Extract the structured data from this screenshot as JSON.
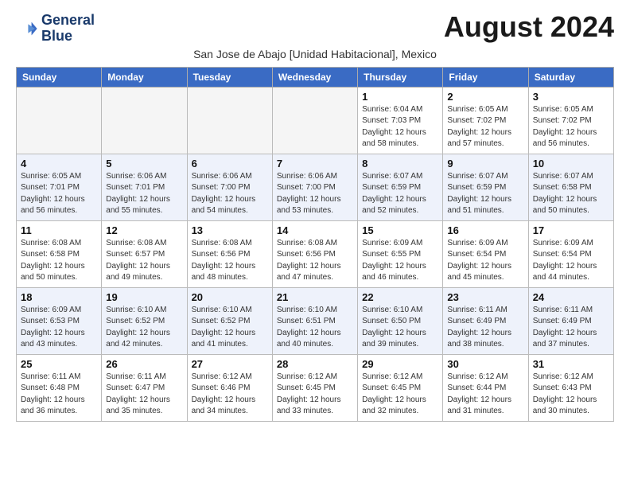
{
  "header": {
    "logo_line1": "General",
    "logo_line2": "Blue",
    "month_year": "August 2024",
    "subtitle": "San Jose de Abajo [Unidad Habitacional], Mexico"
  },
  "days_of_week": [
    "Sunday",
    "Monday",
    "Tuesday",
    "Wednesday",
    "Thursday",
    "Friday",
    "Saturday"
  ],
  "weeks": [
    [
      {
        "num": "",
        "info": ""
      },
      {
        "num": "",
        "info": ""
      },
      {
        "num": "",
        "info": ""
      },
      {
        "num": "",
        "info": ""
      },
      {
        "num": "1",
        "info": "Sunrise: 6:04 AM\nSunset: 7:03 PM\nDaylight: 12 hours\nand 58 minutes."
      },
      {
        "num": "2",
        "info": "Sunrise: 6:05 AM\nSunset: 7:02 PM\nDaylight: 12 hours\nand 57 minutes."
      },
      {
        "num": "3",
        "info": "Sunrise: 6:05 AM\nSunset: 7:02 PM\nDaylight: 12 hours\nand 56 minutes."
      }
    ],
    [
      {
        "num": "4",
        "info": "Sunrise: 6:05 AM\nSunset: 7:01 PM\nDaylight: 12 hours\nand 56 minutes."
      },
      {
        "num": "5",
        "info": "Sunrise: 6:06 AM\nSunset: 7:01 PM\nDaylight: 12 hours\nand 55 minutes."
      },
      {
        "num": "6",
        "info": "Sunrise: 6:06 AM\nSunset: 7:00 PM\nDaylight: 12 hours\nand 54 minutes."
      },
      {
        "num": "7",
        "info": "Sunrise: 6:06 AM\nSunset: 7:00 PM\nDaylight: 12 hours\nand 53 minutes."
      },
      {
        "num": "8",
        "info": "Sunrise: 6:07 AM\nSunset: 6:59 PM\nDaylight: 12 hours\nand 52 minutes."
      },
      {
        "num": "9",
        "info": "Sunrise: 6:07 AM\nSunset: 6:59 PM\nDaylight: 12 hours\nand 51 minutes."
      },
      {
        "num": "10",
        "info": "Sunrise: 6:07 AM\nSunset: 6:58 PM\nDaylight: 12 hours\nand 50 minutes."
      }
    ],
    [
      {
        "num": "11",
        "info": "Sunrise: 6:08 AM\nSunset: 6:58 PM\nDaylight: 12 hours\nand 50 minutes."
      },
      {
        "num": "12",
        "info": "Sunrise: 6:08 AM\nSunset: 6:57 PM\nDaylight: 12 hours\nand 49 minutes."
      },
      {
        "num": "13",
        "info": "Sunrise: 6:08 AM\nSunset: 6:56 PM\nDaylight: 12 hours\nand 48 minutes."
      },
      {
        "num": "14",
        "info": "Sunrise: 6:08 AM\nSunset: 6:56 PM\nDaylight: 12 hours\nand 47 minutes."
      },
      {
        "num": "15",
        "info": "Sunrise: 6:09 AM\nSunset: 6:55 PM\nDaylight: 12 hours\nand 46 minutes."
      },
      {
        "num": "16",
        "info": "Sunrise: 6:09 AM\nSunset: 6:54 PM\nDaylight: 12 hours\nand 45 minutes."
      },
      {
        "num": "17",
        "info": "Sunrise: 6:09 AM\nSunset: 6:54 PM\nDaylight: 12 hours\nand 44 minutes."
      }
    ],
    [
      {
        "num": "18",
        "info": "Sunrise: 6:09 AM\nSunset: 6:53 PM\nDaylight: 12 hours\nand 43 minutes."
      },
      {
        "num": "19",
        "info": "Sunrise: 6:10 AM\nSunset: 6:52 PM\nDaylight: 12 hours\nand 42 minutes."
      },
      {
        "num": "20",
        "info": "Sunrise: 6:10 AM\nSunset: 6:52 PM\nDaylight: 12 hours\nand 41 minutes."
      },
      {
        "num": "21",
        "info": "Sunrise: 6:10 AM\nSunset: 6:51 PM\nDaylight: 12 hours\nand 40 minutes."
      },
      {
        "num": "22",
        "info": "Sunrise: 6:10 AM\nSunset: 6:50 PM\nDaylight: 12 hours\nand 39 minutes."
      },
      {
        "num": "23",
        "info": "Sunrise: 6:11 AM\nSunset: 6:49 PM\nDaylight: 12 hours\nand 38 minutes."
      },
      {
        "num": "24",
        "info": "Sunrise: 6:11 AM\nSunset: 6:49 PM\nDaylight: 12 hours\nand 37 minutes."
      }
    ],
    [
      {
        "num": "25",
        "info": "Sunrise: 6:11 AM\nSunset: 6:48 PM\nDaylight: 12 hours\nand 36 minutes."
      },
      {
        "num": "26",
        "info": "Sunrise: 6:11 AM\nSunset: 6:47 PM\nDaylight: 12 hours\nand 35 minutes."
      },
      {
        "num": "27",
        "info": "Sunrise: 6:12 AM\nSunset: 6:46 PM\nDaylight: 12 hours\nand 34 minutes."
      },
      {
        "num": "28",
        "info": "Sunrise: 6:12 AM\nSunset: 6:45 PM\nDaylight: 12 hours\nand 33 minutes."
      },
      {
        "num": "29",
        "info": "Sunrise: 6:12 AM\nSunset: 6:45 PM\nDaylight: 12 hours\nand 32 minutes."
      },
      {
        "num": "30",
        "info": "Sunrise: 6:12 AM\nSunset: 6:44 PM\nDaylight: 12 hours\nand 31 minutes."
      },
      {
        "num": "31",
        "info": "Sunrise: 6:12 AM\nSunset: 6:43 PM\nDaylight: 12 hours\nand 30 minutes."
      }
    ]
  ]
}
